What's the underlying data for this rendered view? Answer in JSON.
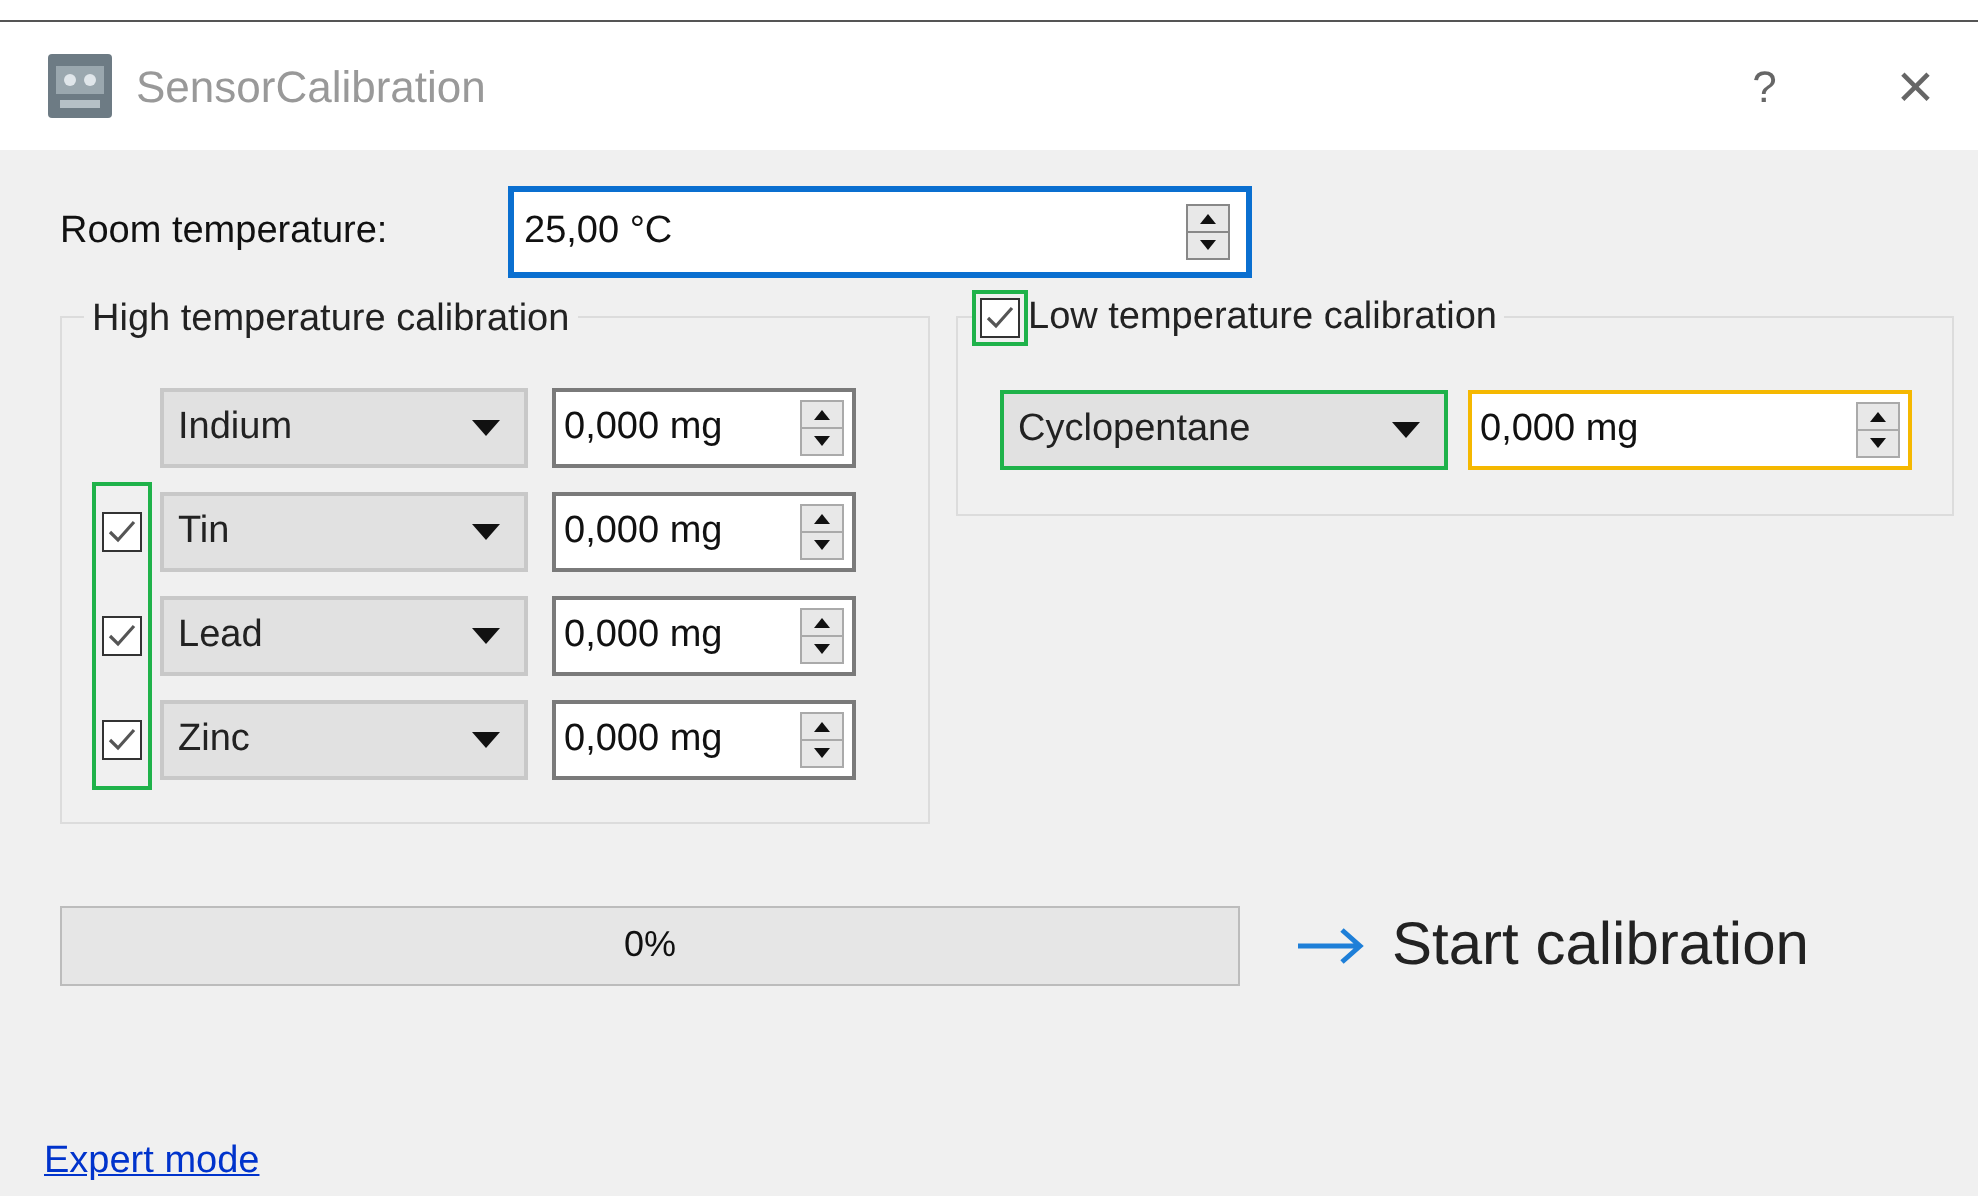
{
  "window": {
    "title": "SensorCalibration",
    "help": "?",
    "close": "×"
  },
  "room_temperature": {
    "label": "Room temperature:",
    "value": "25,00 °C",
    "color": "#0a6fd0"
  },
  "high_group": {
    "title": "High temperature calibration",
    "checkbox_frame": {
      "color": "#1fb24a"
    },
    "rows": [
      {
        "kind": "plain",
        "material": "Indium",
        "mass": "0,000 mg"
      },
      {
        "kind": "checkable",
        "checked": true,
        "material": "Tin",
        "mass": "0,000 mg"
      },
      {
        "kind": "checkable",
        "checked": true,
        "material": "Lead",
        "mass": "0,000 mg"
      },
      {
        "kind": "checkable",
        "checked": true,
        "material": "Zinc",
        "mass": "0,000 mg"
      }
    ]
  },
  "low_group": {
    "title": "Low temperature calibration",
    "checkbox": {
      "checked": true,
      "color": "#1fb24a"
    },
    "material": {
      "text": "Cyclopentane",
      "color": "#1fb24a"
    },
    "mass": {
      "text": "0,000 mg",
      "color": "#f5b800"
    }
  },
  "progress": {
    "text": "0%"
  },
  "start_button": {
    "label": "Start calibration"
  },
  "expert_link": {
    "label": "Expert mode"
  }
}
